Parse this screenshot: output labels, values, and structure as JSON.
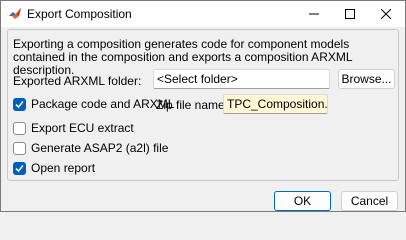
{
  "window": {
    "title": "Export Composition",
    "icon": "matlab-icon",
    "controls": [
      "minimize-icon",
      "maximize-icon",
      "close-icon"
    ]
  },
  "description": "Exporting a composition generates code for component models contained in the composition and exports a composition ARXML description.",
  "arxml_folder": {
    "label": "Exported ARXML folder:",
    "value": "<Select folder>",
    "browse_label": "Browse..."
  },
  "options": {
    "package": {
      "label": "Package code and ARXML",
      "checked": true
    },
    "zip": {
      "label": "Zip file name:",
      "value": "TPC_Composition.zip"
    },
    "ecu": {
      "label": "Export ECU extract",
      "checked": false
    },
    "a2l": {
      "label": "Generate ASAP2 (a2l) file",
      "checked": false
    },
    "report": {
      "label": "Open report",
      "checked": true
    }
  },
  "footer": {
    "ok_label": "OK",
    "cancel_label": "Cancel"
  },
  "colors": {
    "accent": "#005fb8",
    "zip_field_bg": "#fff6d6"
  }
}
